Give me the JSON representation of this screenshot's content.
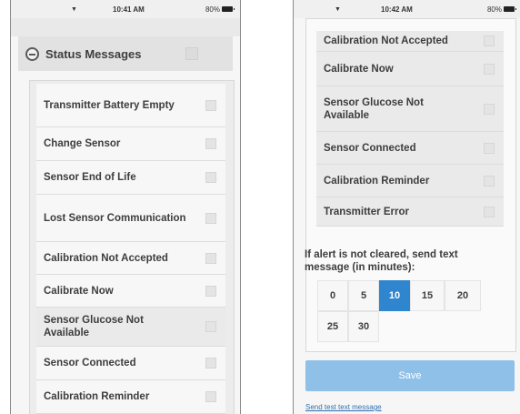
{
  "left": {
    "status_bar": {
      "time": "10:41 AM",
      "battery": "80%"
    },
    "section_title": "Status Messages",
    "rows": [
      {
        "label": "Transmitter Battery Empty"
      },
      {
        "label": "Change Sensor"
      },
      {
        "label": "Sensor End of Life"
      },
      {
        "label": "Lost Sensor Communication"
      },
      {
        "label": "Calibration Not Accepted"
      },
      {
        "label": "Calibrate Now"
      },
      {
        "label": "Sensor Glucose Not Available"
      },
      {
        "label": "Sensor Connected"
      },
      {
        "label": "Calibration Reminder"
      }
    ]
  },
  "right": {
    "status_bar": {
      "time": "10:42 AM",
      "battery": "80%"
    },
    "rows": [
      {
        "label": "Calibration Not Accepted"
      },
      {
        "label": "Calibrate Now"
      },
      {
        "label": "Sensor Glucose Not Available"
      },
      {
        "label": "Sensor Connected"
      },
      {
        "label": "Calibration Reminder"
      },
      {
        "label": "Transmitter Error"
      }
    ],
    "minutes_label": "If alert is not cleared, send text message (in minutes):",
    "minute_options": [
      "0",
      "5",
      "10",
      "15",
      "20",
      "25",
      "30"
    ],
    "selected_minute": "10",
    "save_label": "Save",
    "test_link": "Send test text message"
  },
  "colors": {
    "accent": "#2f86cf",
    "save_disabled": "#8fc0e8"
  }
}
